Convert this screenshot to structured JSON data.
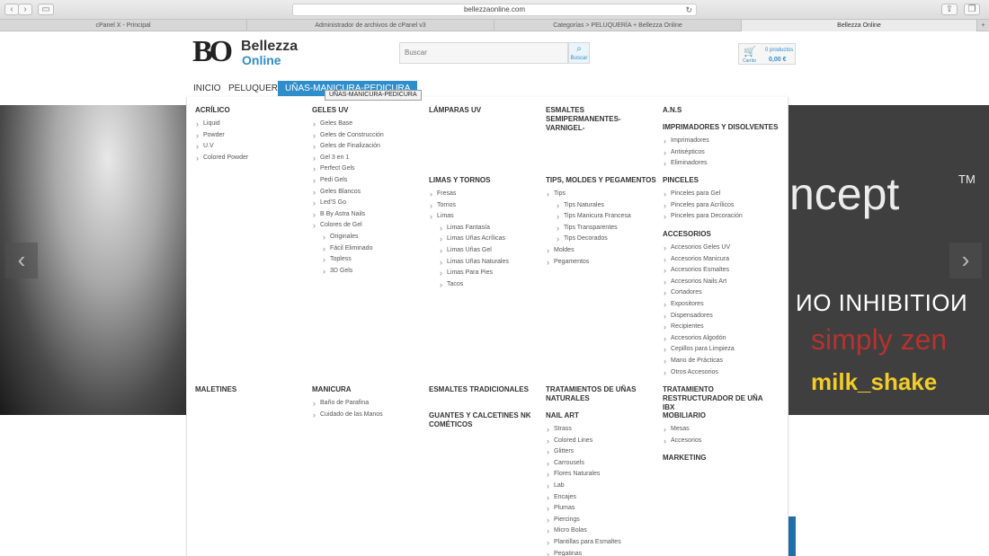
{
  "browser": {
    "url": "bellezzaonline.com",
    "tabs": [
      {
        "label": "cPanel X - Principal"
      },
      {
        "label": "Administrador de archivos de cPanel v3"
      },
      {
        "label": "Categorías > PELUQUERÍA + Bellezza Online"
      },
      {
        "label": "Bellezza Online"
      }
    ]
  },
  "header": {
    "logo_mark": "BO",
    "logo_line1": "Bellezza",
    "logo_line2": "Online",
    "search_placeholder": "Buscar",
    "search_button": "Buscar",
    "cart_label": "Carrito",
    "cart_count": "0 productos",
    "cart_total": "0,00 €"
  },
  "menu": {
    "items": [
      {
        "label": "INICIO"
      },
      {
        "label": "PELUQUERÍA"
      },
      {
        "label": "UÑAS-MANICURA-PEDICURA"
      }
    ],
    "tooltip": "UÑAS-MANICURA-PEDICURA"
  },
  "hero": {
    "brand_concept": "ncept",
    "brand_tm": "TM",
    "brand_inhibition": "ИO INHIBITIOИ",
    "brand_zen": "simply zen",
    "brand_milk": "milk_shake",
    "prev": "‹",
    "next": "›"
  },
  "dropdown": {
    "c1": {
      "title": "ACRÍLICO",
      "items": [
        "Liquid",
        "Powder",
        "U.V",
        "Colored Powder"
      ]
    },
    "c2": {
      "title": "GELES UV",
      "items": [
        "Geles Base",
        "Geles de Construcción",
        "Geles de Finalización",
        "Gel 3 en 1",
        "Perfect Gels",
        "Pedi Gels",
        "Geles Blancos",
        "Led'S Go",
        "B By Astra Nails",
        "Colores de Gel"
      ],
      "sub": [
        "Originales",
        "Fácil Eliminado",
        "Topless",
        "3D Gels"
      ]
    },
    "c3": {
      "title": "LÁMPARAS UV"
    },
    "c4": {
      "title": "ESMALTES SEMIPERMANENTES-VARNIGEL-"
    },
    "c5": {
      "title": "A.N.S"
    },
    "c5b": {
      "title": "IMPRIMADORES Y DISOLVENTES",
      "items": [
        "Imprimadores",
        "Antisépticos",
        "Eliminadores"
      ]
    },
    "c3b": {
      "title": "LIMAS Y TORNOS",
      "items": [
        "Fresas",
        "Tornos",
        "Limas"
      ],
      "sub": [
        "Limas Fantasía",
        "Limas Uñas Acrílicas",
        "Limas Uñas Gel",
        "Limas Uñas Naturales",
        "Limas Para Pies",
        "Tacos"
      ]
    },
    "c4b": {
      "title": "TIPS, MOLDES Y PEGAMENTOS",
      "items": [
        "Tips"
      ],
      "sub": [
        "Tips Naturales",
        "Tips Manicura Francesa",
        "Tips Transparentes",
        "Tips Decorados"
      ],
      "items2": [
        "Moldes",
        "Pegamentos"
      ]
    },
    "c5c": {
      "title": "PINCELES",
      "items": [
        "Pinceles para Gel",
        "Pinceles para Acrílicos",
        "Pinceles para Decoración"
      ]
    },
    "c5d": {
      "title": "ACCESORIOS",
      "items": [
        "Accesorios Geles UV",
        "Accesorios Manicura",
        "Accesorios Esmaltes",
        "Accesorios Nails Art",
        "Cortadores",
        "Expositores",
        "Dispensadores",
        "Recipientes",
        "Accesorios Algodón",
        "Cepillos para Limpieza",
        "Mano de Prácticas",
        "Otros Accesorios"
      ]
    },
    "r2c1": {
      "title": "MALETINES"
    },
    "r2c2": {
      "title": "MANICURA",
      "items": [
        "Baño de Parafina",
        "Cuidado de las Manos"
      ]
    },
    "r2c3": {
      "title": "ESMALTES TRADICIONALES"
    },
    "r2c3b": {
      "title": "GUANTES Y CALCETINES NK COMÉTICOS"
    },
    "r2c4": {
      "title": "TRATAMIENTOS DE UÑAS NATURALES"
    },
    "r2c4b": {
      "title": "NAIL ART",
      "items": [
        "Strass",
        "Colored Lines",
        "Glitters",
        "Carrousels",
        "Flores Naturales",
        "Lab",
        "Encajes",
        "Plumas",
        "Piercings",
        "Micro Bolas",
        "Plantillas para Esmaltes",
        "Pegatinas"
      ]
    },
    "r2c5": {
      "title": "TRATAMIENTO RESTRUCTURADOR DE UÑA IBX"
    },
    "r2c5b": {
      "title": "MOBILIARIO",
      "items": [
        "Mesas",
        "Accesorios"
      ]
    },
    "r2c5c": {
      "title": "MARKETING"
    }
  }
}
